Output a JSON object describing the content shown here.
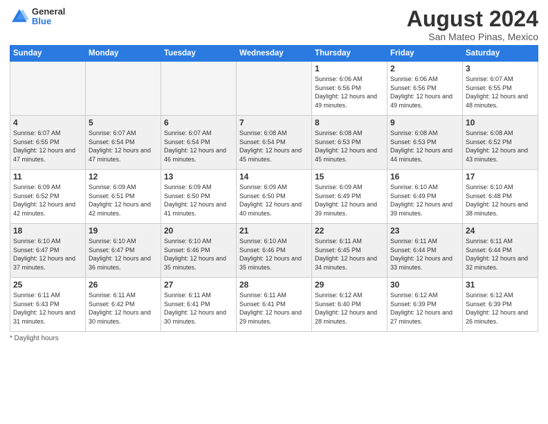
{
  "header": {
    "logo_line1": "General",
    "logo_line2": "Blue",
    "month_title": "August 2024",
    "subtitle": "San Mateo Pinas, Mexico"
  },
  "days_of_week": [
    "Sunday",
    "Monday",
    "Tuesday",
    "Wednesday",
    "Thursday",
    "Friday",
    "Saturday"
  ],
  "weeks": [
    [
      {
        "day": "",
        "info": ""
      },
      {
        "day": "",
        "info": ""
      },
      {
        "day": "",
        "info": ""
      },
      {
        "day": "",
        "info": ""
      },
      {
        "day": "1",
        "info": "Sunrise: 6:06 AM\nSunset: 6:56 PM\nDaylight: 12 hours\nand 49 minutes."
      },
      {
        "day": "2",
        "info": "Sunrise: 6:06 AM\nSunset: 6:56 PM\nDaylight: 12 hours\nand 49 minutes."
      },
      {
        "day": "3",
        "info": "Sunrise: 6:07 AM\nSunset: 6:55 PM\nDaylight: 12 hours\nand 48 minutes."
      }
    ],
    [
      {
        "day": "4",
        "info": "Sunrise: 6:07 AM\nSunset: 6:55 PM\nDaylight: 12 hours\nand 47 minutes."
      },
      {
        "day": "5",
        "info": "Sunrise: 6:07 AM\nSunset: 6:54 PM\nDaylight: 12 hours\nand 47 minutes."
      },
      {
        "day": "6",
        "info": "Sunrise: 6:07 AM\nSunset: 6:54 PM\nDaylight: 12 hours\nand 46 minutes."
      },
      {
        "day": "7",
        "info": "Sunrise: 6:08 AM\nSunset: 6:54 PM\nDaylight: 12 hours\nand 45 minutes."
      },
      {
        "day": "8",
        "info": "Sunrise: 6:08 AM\nSunset: 6:53 PM\nDaylight: 12 hours\nand 45 minutes."
      },
      {
        "day": "9",
        "info": "Sunrise: 6:08 AM\nSunset: 6:53 PM\nDaylight: 12 hours\nand 44 minutes."
      },
      {
        "day": "10",
        "info": "Sunrise: 6:08 AM\nSunset: 6:52 PM\nDaylight: 12 hours\nand 43 minutes."
      }
    ],
    [
      {
        "day": "11",
        "info": "Sunrise: 6:09 AM\nSunset: 6:52 PM\nDaylight: 12 hours\nand 42 minutes."
      },
      {
        "day": "12",
        "info": "Sunrise: 6:09 AM\nSunset: 6:51 PM\nDaylight: 12 hours\nand 42 minutes."
      },
      {
        "day": "13",
        "info": "Sunrise: 6:09 AM\nSunset: 6:50 PM\nDaylight: 12 hours\nand 41 minutes."
      },
      {
        "day": "14",
        "info": "Sunrise: 6:09 AM\nSunset: 6:50 PM\nDaylight: 12 hours\nand 40 minutes."
      },
      {
        "day": "15",
        "info": "Sunrise: 6:09 AM\nSunset: 6:49 PM\nDaylight: 12 hours\nand 39 minutes."
      },
      {
        "day": "16",
        "info": "Sunrise: 6:10 AM\nSunset: 6:49 PM\nDaylight: 12 hours\nand 39 minutes."
      },
      {
        "day": "17",
        "info": "Sunrise: 6:10 AM\nSunset: 6:48 PM\nDaylight: 12 hours\nand 38 minutes."
      }
    ],
    [
      {
        "day": "18",
        "info": "Sunrise: 6:10 AM\nSunset: 6:47 PM\nDaylight: 12 hours\nand 37 minutes."
      },
      {
        "day": "19",
        "info": "Sunrise: 6:10 AM\nSunset: 6:47 PM\nDaylight: 12 hours\nand 36 minutes."
      },
      {
        "day": "20",
        "info": "Sunrise: 6:10 AM\nSunset: 6:46 PM\nDaylight: 12 hours\nand 35 minutes."
      },
      {
        "day": "21",
        "info": "Sunrise: 6:10 AM\nSunset: 6:46 PM\nDaylight: 12 hours\nand 35 minutes."
      },
      {
        "day": "22",
        "info": "Sunrise: 6:11 AM\nSunset: 6:45 PM\nDaylight: 12 hours\nand 34 minutes."
      },
      {
        "day": "23",
        "info": "Sunrise: 6:11 AM\nSunset: 6:44 PM\nDaylight: 12 hours\nand 33 minutes."
      },
      {
        "day": "24",
        "info": "Sunrise: 6:11 AM\nSunset: 6:44 PM\nDaylight: 12 hours\nand 32 minutes."
      }
    ],
    [
      {
        "day": "25",
        "info": "Sunrise: 6:11 AM\nSunset: 6:43 PM\nDaylight: 12 hours\nand 31 minutes."
      },
      {
        "day": "26",
        "info": "Sunrise: 6:11 AM\nSunset: 6:42 PM\nDaylight: 12 hours\nand 30 minutes."
      },
      {
        "day": "27",
        "info": "Sunrise: 6:11 AM\nSunset: 6:41 PM\nDaylight: 12 hours\nand 30 minutes."
      },
      {
        "day": "28",
        "info": "Sunrise: 6:11 AM\nSunset: 6:41 PM\nDaylight: 12 hours\nand 29 minutes."
      },
      {
        "day": "29",
        "info": "Sunrise: 6:12 AM\nSunset: 6:40 PM\nDaylight: 12 hours\nand 28 minutes."
      },
      {
        "day": "30",
        "info": "Sunrise: 6:12 AM\nSunset: 6:39 PM\nDaylight: 12 hours\nand 27 minutes."
      },
      {
        "day": "31",
        "info": "Sunrise: 6:12 AM\nSunset: 6:39 PM\nDaylight: 12 hours\nand 26 minutes."
      }
    ]
  ],
  "footer": {
    "note": "Daylight hours"
  }
}
